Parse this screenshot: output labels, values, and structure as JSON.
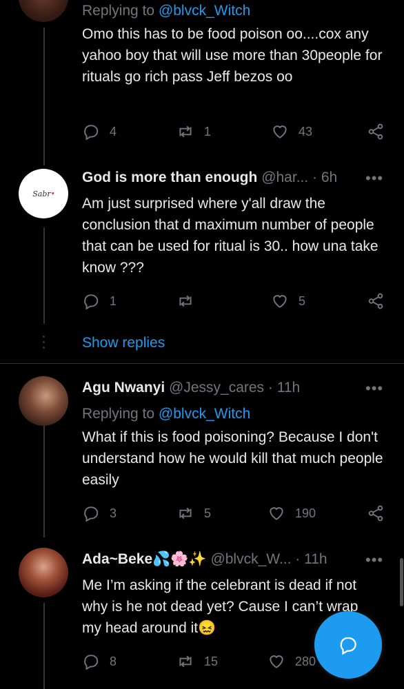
{
  "colors": {
    "background": "#000000",
    "text": "#e7e9ea",
    "muted": "#71767b",
    "accent": "#1d9bf0",
    "divider": "#2f3336"
  },
  "tweet1": {
    "replying_prefix": "Replying to ",
    "replying_handle": "@blvck_Witch",
    "text": "Omo this has to be food poison oo....cox any yahoo boy that will use more than 30people for rituals go rich pass Jeff bezos oo",
    "replies": "4",
    "retweets": "1",
    "likes": "43"
  },
  "tweet2": {
    "avatar_text": "Sabr",
    "name": "God is more than enough",
    "handle": "@har...",
    "time": "· 6h",
    "text": "Am just surprised where y'all draw the conclusion that d maximum number of people that can be used for ritual is 30.. how una take know ???",
    "replies": "1",
    "retweets": "",
    "likes": "5"
  },
  "show_replies": "Show replies",
  "tweet3": {
    "name": "Agu Nwanyi",
    "handle": "@Jessy_cares",
    "time": "· 11h",
    "replying_prefix": "Replying to ",
    "replying_handle": "@blvck_Witch",
    "text": "What if this is food poisoning? Because I don't understand how he would kill that much people easily",
    "replies": "3",
    "retweets": "5",
    "likes": "190"
  },
  "tweet4": {
    "name": "Ada~Beke",
    "name_emoji": "💦🌸✨",
    "handle": "@blvck_W...",
    "time": "· 11h",
    "text": "Me I’m asking if the celebrant is dead if not why is he not dead yet? Cause I can’t wrap my head around it😖",
    "replies": "8",
    "retweets": "15",
    "likes": "280"
  },
  "more_glyph": "•••",
  "icons": {
    "reply": "reply-icon",
    "retweet": "retweet-icon",
    "like": "heart-icon",
    "share": "share-icon",
    "compose": "compose-reply-icon"
  }
}
